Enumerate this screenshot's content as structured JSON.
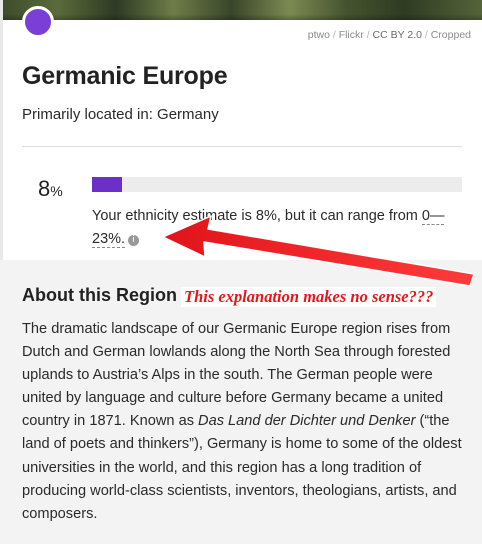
{
  "header": {
    "credit": {
      "author": "ptwo",
      "source": "Flickr",
      "license": "CC BY 2.0",
      "status": "Cropped",
      "separator": "/"
    },
    "marker_color": "#7a3fd6"
  },
  "region": {
    "title": "Germanic Europe",
    "located_label": "Primarily located in: Germany"
  },
  "estimate": {
    "percent_value": "8",
    "percent_unit": "%",
    "fill_fraction": 0.08,
    "bar_color": "#6a30c8",
    "text_prefix": "Your ethnicity estimate is 8%, but it can range from",
    "range": "0—23%.",
    "info_icon": "info-icon"
  },
  "about": {
    "title": "About this Region",
    "annotation": "This explanation makes no sense???",
    "body_part1": "The dramatic landscape of our Germanic Europe region rises from Dutch and German lowlands along the North Sea through forested uplands to Austria’s Alps in the south. The German people were united by language and culture before Germany became a united country in 1871. Known as ",
    "body_italic": "Das Land der Dichter und Denker",
    "body_part2": " (“the land of poets and thinkers”), Germany is home to some of the oldest universities in the world, and this region has a long tradition of producing world-class scientists, inventors, theologians, artists, and composers."
  },
  "annotation_color": "#e4171c"
}
